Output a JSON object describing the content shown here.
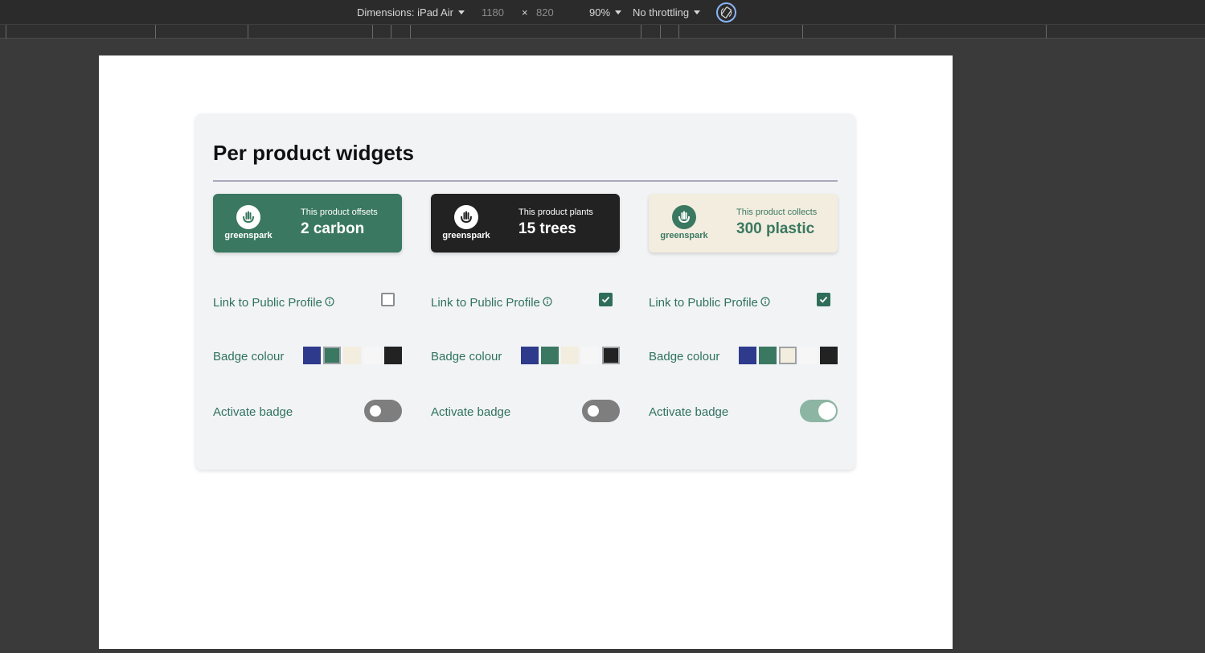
{
  "devtools": {
    "device_label": "Dimensions: iPad Air",
    "width": "1180",
    "times": "×",
    "height": "820",
    "zoom": "90%",
    "throttling": "No throttling"
  },
  "panel": {
    "title": "Per product widgets"
  },
  "colors": {
    "swatches": [
      "#2e3a8c",
      "#3a7861",
      "#f3eddf",
      "#f6f6f6",
      "#222222"
    ],
    "brand_green": "#3a7861",
    "label_green": "#2f7260"
  },
  "widgets": [
    {
      "logo_text": "greenspark",
      "pre_text": "This product offsets",
      "main_text": "2 carbon",
      "bg": "#3a7861",
      "fg": "#ffffff",
      "link_label": "Link to Public Profile",
      "link_checked": false,
      "colour_label": "Badge colour",
      "selected_swatch": 1,
      "activate_label": "Activate badge",
      "active": false
    },
    {
      "logo_text": "greenspark",
      "pre_text": "This product plants",
      "main_text": "15 trees",
      "bg": "#222222",
      "fg": "#ffffff",
      "link_label": "Link to Public Profile",
      "link_checked": true,
      "colour_label": "Badge colour",
      "selected_swatch": 4,
      "activate_label": "Activate badge",
      "active": false
    },
    {
      "logo_text": "greenspark",
      "pre_text": "This product collects",
      "main_text": "300 plastic",
      "bg": "#f3eddf",
      "fg": "#3a7861",
      "link_label": "Link to Public Profile",
      "link_checked": true,
      "colour_label": "Badge colour",
      "selected_swatch": 2,
      "activate_label": "Activate badge",
      "active": true
    }
  ]
}
